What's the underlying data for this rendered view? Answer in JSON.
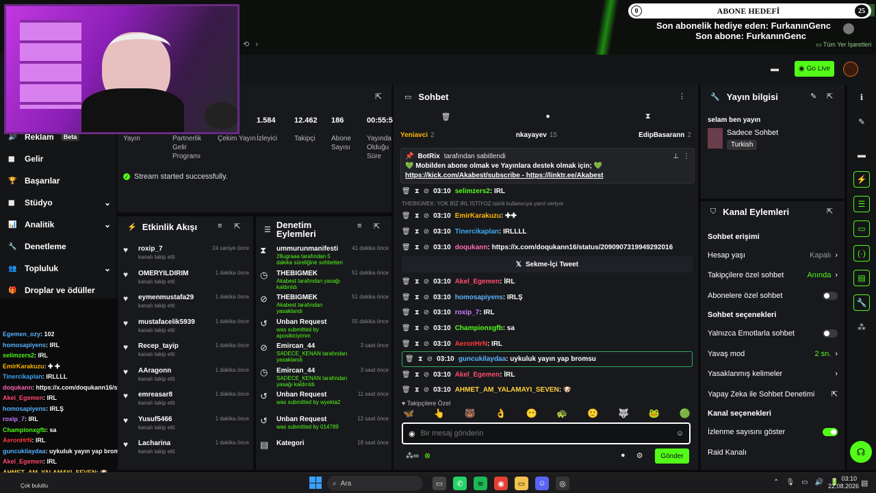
{
  "overlay": {
    "goal_value": "0",
    "goal_title": "ABONE HEDEFİ",
    "goal_target": "25",
    "gift_line": "Son abonelik hediye eden: FurkanınGenc",
    "sub_line": "Son abone: FurkanınGenc"
  },
  "browser": {
    "bookmarks": "Tüm Yer İşaretleri"
  },
  "topbar": {
    "go_live": "Go Live"
  },
  "stats": [
    {
      "value": "",
      "label": "Yayın"
    },
    {
      "value": "",
      "label": "Partnerlik Gelir Programı"
    },
    {
      "value": "",
      "label": "Çekim Yayın"
    },
    {
      "value": "1.584",
      "label": "İzleyici"
    },
    {
      "value": "12.462",
      "label": "Takipçi"
    },
    {
      "value": "186",
      "label": "Abone Sayısı"
    },
    {
      "value": "00:55:5",
      "label": "Yayında Olduğu Süre"
    }
  ],
  "status_msg": "Stream started successfully.",
  "nav": [
    {
      "label": "Reklam",
      "badge": "Beta"
    },
    {
      "label": "Gelir"
    },
    {
      "label": "Başarılar"
    },
    {
      "label": "Stüdyo",
      "chevron": "⌄"
    },
    {
      "label": "Analitik",
      "chevron": "⌄"
    },
    {
      "label": "Denetleme"
    },
    {
      "label": "Topluluk",
      "chevron": "⌄"
    },
    {
      "label": "Droplar ve ödüller"
    }
  ],
  "activity": {
    "title": "Etkinlik Akışı",
    "items": [
      {
        "name": "roxip_7",
        "sub": "kanalı takip etti",
        "time": "24 saniye önce"
      },
      {
        "name": "OMERYILDIRIM",
        "sub": "kanalı takip etti",
        "time": "1 dakika önce"
      },
      {
        "name": "eymenmustafa29",
        "sub": "kanalı takip etti",
        "time": "1 dakika önce"
      },
      {
        "name": "mustafacelik5939",
        "sub": "kanalı takip etti",
        "time": "1 dakika önce"
      },
      {
        "name": "Recep_tayip",
        "sub": "kanalı takip etti",
        "time": "1 dakika önce"
      },
      {
        "name": "AAragonn",
        "sub": "kanalı takip etti",
        "time": "1 dakika önce"
      },
      {
        "name": "emreasar8",
        "sub": "kanalı takip etti",
        "time": "1 dakika önce"
      },
      {
        "name": "Yusuf5466",
        "sub": "kanalı takip etti",
        "time": "1 dakika önce"
      },
      {
        "name": "Lacharina",
        "sub": "kanalı takip etti",
        "time": "1 dakika önce"
      }
    ]
  },
  "modlog": {
    "title": "Denetim Eylemleri",
    "items": [
      {
        "icon": "⧗",
        "name": "ummurunmanifesti",
        "sub": "28ugraaa tarafından 5 dakika süreliğine sohbetten uzaklaştırıldı",
        "time": "41 dakika önce"
      },
      {
        "icon": "◷",
        "name": "THEBIGMEK",
        "sub": "Akabest tarafından yasağı kaldırıldı",
        "time": "51 dakika önce"
      },
      {
        "icon": "⊘",
        "name": "THEBIGMEK",
        "sub": "Akabest tarafından yasaklandı",
        "time": "51 dakika önce"
      },
      {
        "icon": "↺",
        "name": "Unban Request",
        "sub": "was submitted by aposikiciyimm",
        "time": "55 dakika önce"
      },
      {
        "icon": "⊘",
        "name": "Emircan_44",
        "sub": "SADECE_KENAN tarafından yasaklandı",
        "time": "3 saat önce"
      },
      {
        "icon": "◷",
        "name": "Emircan_44",
        "sub": "SADECE_KENAN tarafından yasağı kaldırıldı",
        "time": "3 saat önce"
      },
      {
        "icon": "↺",
        "name": "Unban Request",
        "sub": "was submitted by wyekta2",
        "time": "11 saat önce"
      },
      {
        "icon": "↺",
        "name": "Unban Request",
        "sub": "was submitted by 014789",
        "time": "12 saat önce"
      },
      {
        "icon": "▤",
        "name": "Kategori",
        "sub": "",
        "time": "18 saat önce"
      }
    ]
  },
  "chat": {
    "title": "Sohbet",
    "top_users": [
      {
        "name": "Yeniavci",
        "count": "2"
      },
      {
        "name": "nkayayev",
        "count": "15"
      },
      {
        "name": "EdipBasarann",
        "count": "2"
      }
    ],
    "pinned": {
      "by": "BotRix",
      "by_suffix": "tarafından sabitlendi",
      "text": "💚 Mobilden abone olmak ve Yayınlara destek olmak için; 💚",
      "link1": "https://kick.com/Akabest/subscribe",
      "sep": " - ",
      "link2": "https://linktr.ee/Akabest"
    },
    "reply_note": "THEBIGMEK: YOK BİZ IRL İSTİYOZ isimli kullanıcıya yanıt veriyor",
    "messages": [
      {
        "time": "03:10",
        "user": "selimzers2",
        "color": "#53fc18",
        "text": ": IRL"
      },
      {
        "time": "03:10",
        "user": "EmirKarakuzu",
        "color": "#ffb800",
        "text": ": ✚✚"
      },
      {
        "time": "03:10",
        "user": "Tinercikaplan",
        "color": "#3fa9f5",
        "text": ": IRLLLL"
      },
      {
        "time": "03:10",
        "user": "doqukann",
        "color": "#ff69b4",
        "text": ": https://x.com/doqukann16/status/2090907319949292016"
      },
      {
        "time": "03:10",
        "user": "Akel_Egemen",
        "color": "#ff4d6d",
        "text": ": İRL"
      },
      {
        "time": "03:10",
        "user": "homosapiyens",
        "color": "#5ab4ff",
        "text": ": IRLŞ"
      },
      {
        "time": "03:10",
        "user": "roxip_7",
        "color": "#c77dff",
        "text": ": IRL"
      },
      {
        "time": "03:10",
        "user": "Championxgfb",
        "color": "#53fc18",
        "text": ": sa"
      },
      {
        "time": "03:10",
        "user": "AeronHrN",
        "color": "#ff3b3b",
        "text": ": IRL"
      },
      {
        "time": "03:10",
        "user": "guncukilaydaa",
        "color": "#5ab4ff",
        "text": ": uykuluk yayın yap bromsu"
      },
      {
        "time": "03:10",
        "user": "Akel_Egemen",
        "color": "#ff4d6d",
        "text": ": İRL"
      },
      {
        "time": "03:10",
        "user": "AHMET_AM_YALAMAYI_SEVEN",
        "color": "#ffd23f",
        "text": ": 🐶"
      }
    ],
    "tweet_label": "Sekme-İçi Tweet",
    "followers_only": "Takipçilere Özel",
    "placeholder": "Bir mesaj gönderin",
    "send": "Gönder"
  },
  "info": {
    "title": "Yayın bilgisi",
    "stream_title": "selam ben yayın",
    "category": "Sadece Sohbet",
    "tag": "Turkish"
  },
  "actions": {
    "title": "Kanal Eylemleri",
    "s1": "Sohbet erişimi",
    "rows1": [
      {
        "label": "Hesap yaşı",
        "value": "Kapalı",
        "type": "chev"
      },
      {
        "label": "Takipçilere özel sohbet",
        "value": "Anında",
        "type": "chev"
      },
      {
        "label": "Abonelere özel sohbet",
        "type": "toggle"
      }
    ],
    "s2": "Sohbet seçenekleri",
    "rows2": [
      {
        "label": "Yalnızca Emotlarla sohbet",
        "type": "toggle"
      },
      {
        "label": "Yavaş mod",
        "value": "2 sn.",
        "type": "chev"
      },
      {
        "label": "Yasaklanmış kelimeler",
        "type": "chev"
      },
      {
        "label": "Yapay Zeka ile Sohbet Denetimi",
        "type": "ext"
      }
    ],
    "s3": "Kanal seçenekleri",
    "rows3": [
      {
        "label": "İzlenme sayısını göster",
        "type": "toggle_on"
      },
      {
        "label": "Raid Kanalı",
        "type": "none"
      }
    ]
  },
  "overlay_chat": [
    {
      "user": "Egemen_ozy",
      "color": "#5ab4ff",
      "text": ": 102"
    },
    {
      "user": "homosapiyens",
      "color": "#5ab4ff",
      "text": ": IRL"
    },
    {
      "user": "selimzers2",
      "color": "#53fc18",
      "text": ": IRL"
    },
    {
      "user": "EmirKarakuzu",
      "color": "#ffb800",
      "text": ": ✚ ✚"
    },
    {
      "user": "Tinercikaplan",
      "color": "#3fa9f5",
      "text": ": IRLLLL"
    },
    {
      "user": "doqukann",
      "color": "#ff69b4",
      "text": ": https://x.com/doqukann16/status/2090907319949292016"
    },
    {
      "user": "Akel_Egemen",
      "color": "#ff4d6d",
      "text": ": IRL"
    },
    {
      "user": "homosapiyens",
      "color": "#5ab4ff",
      "text": ": IRLŞ"
    },
    {
      "user": "roxip_7",
      "color": "#c77dff",
      "text": ": IRL"
    },
    {
      "user": "Championxgfb",
      "color": "#53fc18",
      "text": ": sa"
    },
    {
      "user": "AeronHrN",
      "color": "#ff3b3b",
      "text": ": IRL"
    },
    {
      "user": "guncukilaydaa",
      "color": "#5ab4ff",
      "text": ": uykuluk yayın yap bromsu"
    },
    {
      "user": "Akel_Egemen",
      "color": "#ff4d6d",
      "text": ": IRL"
    },
    {
      "user": "AHMET_AM_YALAMAYI_SEVEN",
      "color": "#ffd23f",
      "text": ": 🐶"
    }
  ],
  "taskbar": {
    "weather": "Çok bulutlu",
    "search": "Ara",
    "time": "03:10",
    "date": "22.08.2026"
  }
}
